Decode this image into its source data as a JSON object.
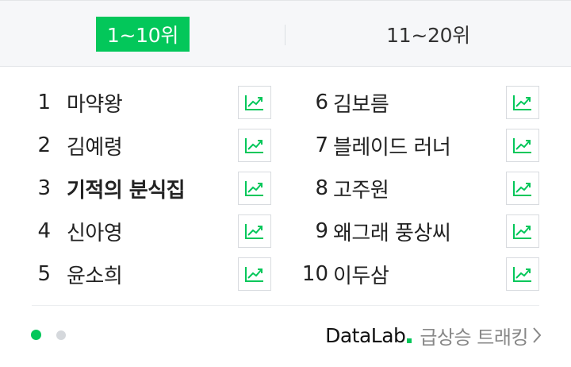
{
  "tabs": [
    {
      "label": "1~10위",
      "active": true
    },
    {
      "label": "11~20위",
      "active": false
    }
  ],
  "left_items": [
    {
      "rank": "1",
      "keyword": "마약왕"
    },
    {
      "rank": "2",
      "keyword": "김예령"
    },
    {
      "rank": "3",
      "keyword": "기적의 분식집"
    },
    {
      "rank": "4",
      "keyword": "신아영"
    },
    {
      "rank": "5",
      "keyword": "윤소희"
    }
  ],
  "right_items": [
    {
      "rank": "6",
      "keyword": "김보름"
    },
    {
      "rank": "7",
      "keyword": "블레이드 러너"
    },
    {
      "rank": "8",
      "keyword": "고주원"
    },
    {
      "rank": "9",
      "keyword": "왜그래 풍상씨"
    },
    {
      "rank": "10",
      "keyword": "이두삼"
    }
  ],
  "footer": {
    "logo": "DataLab",
    "link_text": "급상승 트래킹",
    "page_dots": 2,
    "active_dot": 1
  },
  "colors": {
    "accent": "#03c75a",
    "tab_bg": "#f6f7f9",
    "inactive_dot": "#d5d8dc"
  },
  "icons": {
    "trend": "trend-chart-icon",
    "arrow": "chevron-right-icon"
  }
}
